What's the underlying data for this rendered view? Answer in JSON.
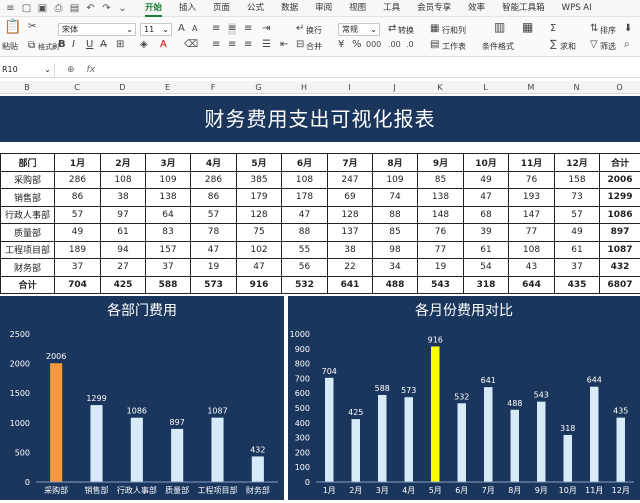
{
  "menubar": {
    "tabs": [
      "开始",
      "插入",
      "页面",
      "公式",
      "数据",
      "审阅",
      "视图",
      "工具",
      "会员专享",
      "效率",
      "智能工具箱",
      "WPS AI"
    ],
    "active_tab": "开始"
  },
  "ribbon": {
    "paste_label": "粘贴",
    "format_brush_label": "格式刷",
    "font_name": "宋体",
    "font_size": "11",
    "wrap_label": "换行",
    "merge_label": "合并",
    "number_format": "常规",
    "convert_label": "转换",
    "row_col_label": "行和列",
    "worksheet_label": "工作表",
    "cond_format_label": "条件格式",
    "sum_label": "求和",
    "filter_label": "筛选",
    "sort_label": "排序",
    "fill_label": "填充",
    "find_label": "查找"
  },
  "formula_bar": {
    "name_box": "R10",
    "fx_label": "fx"
  },
  "columns": [
    "B",
    "C",
    "D",
    "E",
    "F",
    "G",
    "H",
    "I",
    "J",
    "K",
    "L",
    "M",
    "N",
    "O"
  ],
  "report": {
    "title": "财务费用支出可视化报表",
    "header": [
      "部门",
      "1月",
      "2月",
      "3月",
      "4月",
      "5月",
      "6月",
      "7月",
      "8月",
      "9月",
      "10月",
      "11月",
      "12月",
      "合计"
    ],
    "rows": [
      [
        "采购部",
        "286",
        "108",
        "109",
        "286",
        "385",
        "108",
        "247",
        "109",
        "85",
        "49",
        "76",
        "158",
        "2006"
      ],
      [
        "销售部",
        "86",
        "38",
        "138",
        "86",
        "179",
        "178",
        "69",
        "74",
        "138",
        "47",
        "193",
        "73",
        "1299"
      ],
      [
        "行政人事部",
        "57",
        "97",
        "64",
        "57",
        "128",
        "47",
        "128",
        "88",
        "148",
        "68",
        "147",
        "57",
        "1086"
      ],
      [
        "质量部",
        "49",
        "61",
        "83",
        "78",
        "75",
        "88",
        "137",
        "85",
        "76",
        "39",
        "77",
        "49",
        "897"
      ],
      [
        "工程项目部",
        "189",
        "94",
        "157",
        "47",
        "102",
        "55",
        "38",
        "98",
        "77",
        "61",
        "108",
        "61",
        "1087"
      ],
      [
        "财务部",
        "37",
        "27",
        "37",
        "19",
        "47",
        "56",
        "22",
        "34",
        "19",
        "54",
        "43",
        "37",
        "432"
      ]
    ],
    "total_row": [
      "合计",
      "704",
      "425",
      "588",
      "573",
      "916",
      "532",
      "641",
      "488",
      "543",
      "318",
      "644",
      "435",
      "6807"
    ]
  },
  "chart_data": [
    {
      "type": "bar",
      "title": "各部门费用",
      "categories": [
        "采购部",
        "销售部",
        "行政人事部",
        "质量部",
        "工程项目部",
        "财务部"
      ],
      "values": [
        2006,
        1299,
        1086,
        897,
        1087,
        432
      ],
      "ylim": [
        0,
        2500
      ],
      "yticks": [
        0,
        500,
        1000,
        1500,
        2000,
        2500
      ],
      "highlight_index": 0,
      "bar_color": "#d6eaf8",
      "highlight_color": "#f59a3a"
    },
    {
      "type": "bar",
      "title": "各月份费用对比",
      "categories": [
        "1月",
        "2月",
        "3月",
        "4月",
        "5月",
        "6月",
        "7月",
        "8月",
        "9月",
        "10月",
        "11月",
        "12月"
      ],
      "values": [
        704,
        425,
        588,
        573,
        916,
        532,
        641,
        488,
        543,
        318,
        644,
        435
      ],
      "ylim": [
        0,
        1000
      ],
      "yticks": [
        0,
        100,
        200,
        300,
        400,
        500,
        600,
        700,
        800,
        900,
        1000
      ],
      "highlight_index": 4,
      "bar_color": "#d6eaf8",
      "highlight_color": "#ffff00"
    }
  ]
}
